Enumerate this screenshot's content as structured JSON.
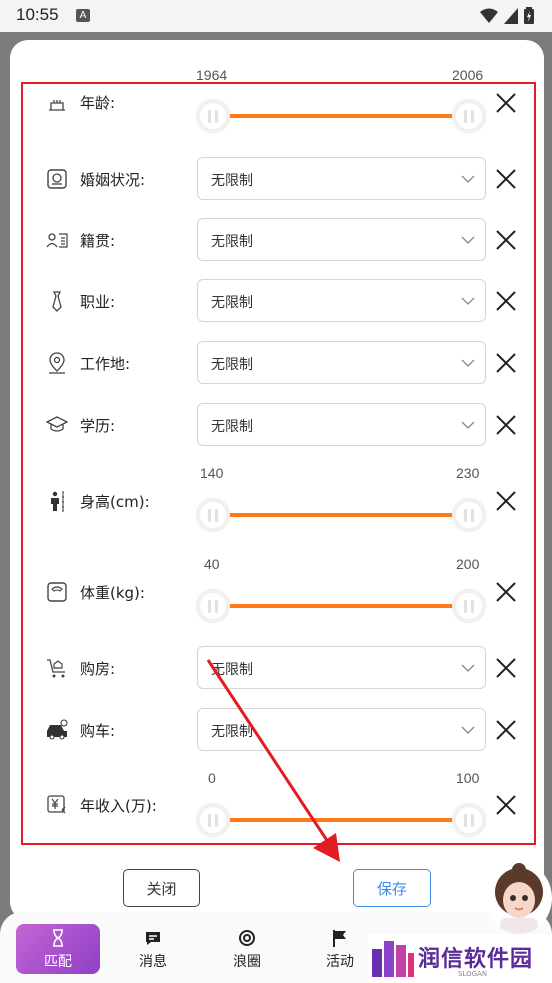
{
  "status_bar": {
    "time": "10:55",
    "notification_letter": "A"
  },
  "rows": [
    {
      "label": "年龄:",
      "type": "slider",
      "min": "1964",
      "max": "2006",
      "icon": "birthday-cake-icon"
    },
    {
      "label": "婚姻状况:",
      "type": "select",
      "value": "无限制",
      "icon": "marriage-certificate-icon"
    },
    {
      "label": "籍贯:",
      "type": "select",
      "value": "无限制",
      "icon": "id-card-icon"
    },
    {
      "label": "职业:",
      "type": "select",
      "value": "无限制",
      "icon": "necktie-icon"
    },
    {
      "label": "工作地:",
      "type": "select",
      "value": "无限制",
      "icon": "location-pin-icon"
    },
    {
      "label": "学历:",
      "type": "select",
      "value": "无限制",
      "icon": "graduation-cap-icon"
    },
    {
      "label": "身高(cm):",
      "type": "slider",
      "min": "140",
      "max": "230",
      "icon": "person-height-icon"
    },
    {
      "label": "体重(kg):",
      "type": "slider",
      "min": "40",
      "max": "200",
      "icon": "weight-scale-icon"
    },
    {
      "label": "购房:",
      "type": "select",
      "value": "无限制",
      "icon": "house-cart-icon"
    },
    {
      "label": "购车:",
      "type": "select",
      "value": "无限制",
      "icon": "car-icon"
    },
    {
      "label": "年收入(万):",
      "type": "slider",
      "min": "0",
      "max": "100",
      "icon": "yuan-income-icon"
    }
  ],
  "buttons": {
    "close": "关闭",
    "save": "保存"
  },
  "tabs": [
    {
      "label": "匹配",
      "icon": "hourglass-icon",
      "active": true
    },
    {
      "label": "消息",
      "icon": "message-icon",
      "active": false
    },
    {
      "label": "浪圈",
      "icon": "circle-swirl-icon",
      "active": false
    },
    {
      "label": "活动",
      "icon": "flag-icon",
      "active": false
    }
  ],
  "brand": {
    "name": "润信软件园",
    "slogan": "SLOGAN"
  },
  "colors": {
    "slider_fill": "#ff7a14",
    "highlight": "#e31b23",
    "save": "#3b8ce6",
    "active_tab": "#a84fcd"
  }
}
